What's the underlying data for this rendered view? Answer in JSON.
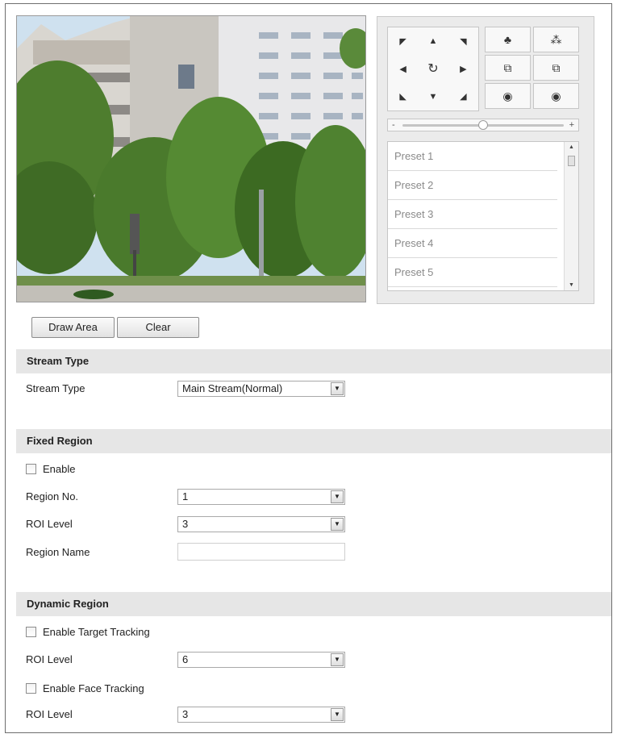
{
  "ptz": {
    "direction_buttons": [
      {
        "name": "pan-up-left-icon",
        "glyph": "◤"
      },
      {
        "name": "pan-up-icon",
        "glyph": "▲"
      },
      {
        "name": "pan-up-right-icon",
        "glyph": "◥"
      },
      {
        "name": "pan-left-icon",
        "glyph": "◀"
      },
      {
        "name": "auto-pan-icon",
        "glyph": "↻"
      },
      {
        "name": "pan-right-icon",
        "glyph": "▶"
      },
      {
        "name": "pan-down-left-icon",
        "glyph": "◣"
      },
      {
        "name": "pan-down-icon",
        "glyph": "▼"
      },
      {
        "name": "pan-down-right-icon",
        "glyph": "◢"
      }
    ],
    "function_buttons": [
      {
        "name": "zoom-in-icon",
        "glyph": "♣"
      },
      {
        "name": "zoom-out-icon",
        "glyph": "⁂"
      },
      {
        "name": "focus-near-icon",
        "glyph": "⧉"
      },
      {
        "name": "focus-far-icon",
        "glyph": "⧉"
      },
      {
        "name": "iris-open-icon",
        "glyph": "◉"
      },
      {
        "name": "iris-close-icon",
        "glyph": "◉"
      }
    ],
    "speed": {
      "minus": "-",
      "plus": "+",
      "level": 0.5
    },
    "presets": [
      "Preset 1",
      "Preset 2",
      "Preset 3",
      "Preset 4",
      "Preset 5"
    ]
  },
  "actions": {
    "draw_area": "Draw Area",
    "clear": "Clear"
  },
  "stream_section": {
    "title": "Stream Type",
    "stream_type_label": "Stream Type",
    "stream_type_value": "Main Stream(Normal)"
  },
  "fixed_section": {
    "title": "Fixed Region",
    "enable_label": "Enable",
    "enable_checked": false,
    "region_no_label": "Region No.",
    "region_no_value": "1",
    "roi_level_label": "ROI Level",
    "roi_level_value": "3",
    "region_name_label": "Region Name",
    "region_name_value": ""
  },
  "dynamic_section": {
    "title": "Dynamic Region",
    "target_tracking_label": "Enable Target Tracking",
    "target_tracking_checked": false,
    "target_roi_label": "ROI Level",
    "target_roi_value": "6",
    "face_tracking_label": "Enable Face Tracking",
    "face_tracking_checked": false,
    "face_roi_label": "ROI Level",
    "face_roi_value": "3"
  },
  "colors": {
    "section_bar": "#e6e6e6",
    "panel_bg": "#ebebeb",
    "preset_text": "#8a8a8a"
  }
}
